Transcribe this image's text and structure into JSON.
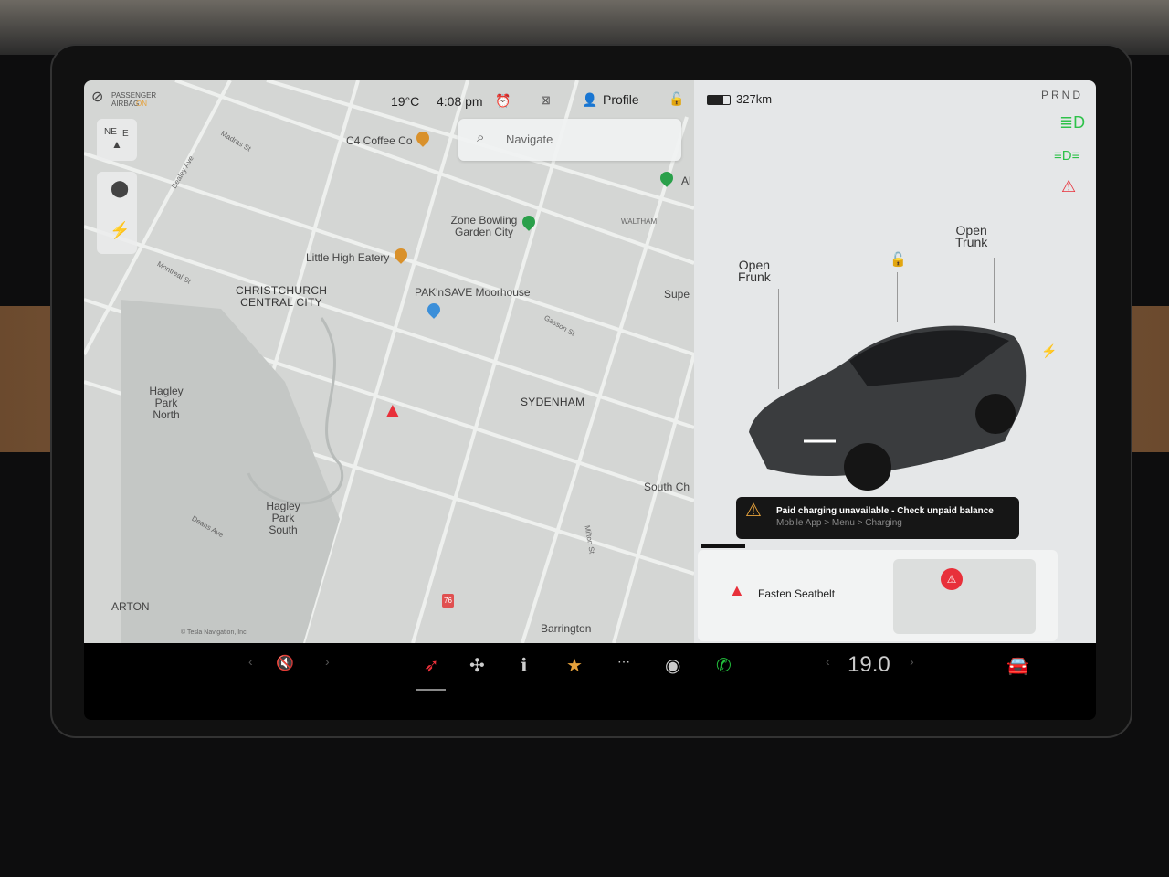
{
  "status_bar": {
    "airbag_line1": "PASSENGER",
    "airbag_line2": "AIRBAG",
    "airbag_state": "ON",
    "temperature": "19°C",
    "time": "4:08 pm",
    "profile": "Profile",
    "range": "327km",
    "gears": "PRND"
  },
  "map": {
    "search_placeholder": "Navigate",
    "compass": {
      "ne": "NE",
      "e": "E"
    },
    "places": [
      "C4 Coffee Co",
      "Zone Bowling Garden City",
      "Little High Eatery",
      "PAK'nSAVE Moorhouse",
      "Barrington",
      "Al"
    ],
    "areas": [
      "CHRISTCHURCH CENTRAL CITY",
      "SYDENHAM",
      "WALTHAM",
      "Hagley Park North",
      "Hagley Park South",
      "ARTON",
      "South Ch",
      "Supe"
    ],
    "streets": [
      "Madras St",
      "Barbadoes St",
      "Bealey Ave",
      "Montreal St",
      "Gasson St",
      "Deans Ave",
      "Milton St"
    ],
    "route_badge": "76",
    "attribution": "© Tesla Navigation, Inc."
  },
  "car": {
    "frunk": "Open\nFrunk",
    "trunk": "Open\nTrunk"
  },
  "alert": {
    "title": "Paid charging unavailable - Check unpaid balance",
    "subtitle": "Mobile App > Menu > Charging"
  },
  "seatbelt": {
    "message": "Fasten Seatbelt"
  },
  "dock": {
    "cabin_temp": "19.0"
  },
  "colors": {
    "accent_red": "#e8303a",
    "indicator_green": "#2ec24a",
    "warning_orange": "#e6a23c",
    "phone_green": "#22c03c"
  }
}
